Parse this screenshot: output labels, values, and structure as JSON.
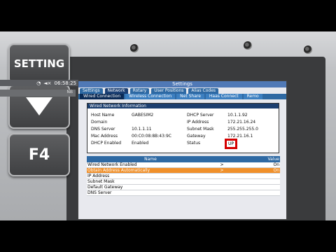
{
  "keys": {
    "setting": "SETTING",
    "f4": "F4"
  },
  "status": {
    "time": "06:58:25",
    "nb": "NB"
  },
  "window": {
    "title": "Settings"
  },
  "tabs": [
    "Settings",
    "Network",
    "Rotary",
    "User Positions",
    "Alias Codes"
  ],
  "subtabs": [
    "Wired Connection",
    "Wireless Connection",
    "Net Share",
    "Haas Connect",
    "Remo"
  ],
  "panel": {
    "title": "Wired Network Information",
    "left": [
      {
        "label": "Host Name",
        "value": "GABESIM2"
      },
      {
        "label": "Domain",
        "value": ""
      },
      {
        "label": "DNS Server",
        "value": "10.1.1.11"
      },
      {
        "label": "Mac Address",
        "value": "00:C0:08:8B:43:9C"
      },
      {
        "label": "DHCP Enabled",
        "value": "Enabled"
      }
    ],
    "right": [
      {
        "label": "DHCP Server",
        "value": "10.1.1.92"
      },
      {
        "label": "IP Address",
        "value": "172.21.16.24"
      },
      {
        "label": "Subnet Mask",
        "value": "255.255.255.0"
      },
      {
        "label": "Gateway",
        "value": "172.21.16.1"
      },
      {
        "label": "Status",
        "value": "UP"
      }
    ]
  },
  "table": {
    "headers": {
      "name": "Name",
      "value": "Value"
    },
    "rows": [
      {
        "name": "Wired Network Enabled",
        "arrow": ">",
        "value": "On"
      },
      {
        "name": "Obtain Address Automatically",
        "arrow": ">",
        "value": "On"
      },
      {
        "name": "IP Address",
        "arrow": "",
        "value": ""
      },
      {
        "name": "Subnet Mask",
        "arrow": "",
        "value": ""
      },
      {
        "name": "Default Gateway",
        "arrow": "",
        "value": ""
      },
      {
        "name": "DNS Server",
        "arrow": "",
        "value": ""
      }
    ]
  },
  "colors": {
    "accent": "#2e69a3",
    "highlight": "#f0902a",
    "status_box": "#d40000"
  }
}
